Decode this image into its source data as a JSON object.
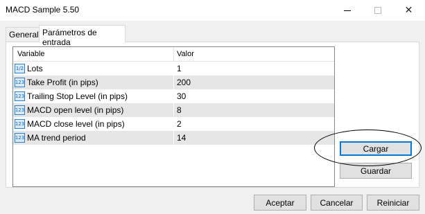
{
  "window": {
    "title": "MACD Sample 5.50",
    "controls": {
      "minimize": "minimize-icon",
      "maximize": "maximize-icon",
      "close": "close-icon"
    }
  },
  "tabs": [
    {
      "label": "General",
      "active": false
    },
    {
      "label": "Parámetros de entrada",
      "active": true
    }
  ],
  "grid": {
    "headers": {
      "variable": "Variable",
      "value": "Valor"
    },
    "rows": [
      {
        "name": "Lots",
        "value": "1",
        "type_icon": "1/2"
      },
      {
        "name": "Take Profit (in pips)",
        "value": "200",
        "type_icon": "123"
      },
      {
        "name": "Trailing Stop Level (in pips)",
        "value": "30",
        "type_icon": "123"
      },
      {
        "name": "MACD open level (in pips)",
        "value": "8",
        "type_icon": "123"
      },
      {
        "name": "MACD close level (in pips)",
        "value": "2",
        "type_icon": "123"
      },
      {
        "name": "MA trend period",
        "value": "14",
        "type_icon": "123"
      }
    ]
  },
  "side_buttons": {
    "load": "Cargar",
    "save": "Guardar"
  },
  "footer_buttons": {
    "ok": "Aceptar",
    "cancel": "Cancelar",
    "reset": "Reiniciar"
  },
  "colors": {
    "focus_border": "#0078d7",
    "icon_blue": "#2a7fd4",
    "alt_row": "#e6e6e6"
  }
}
